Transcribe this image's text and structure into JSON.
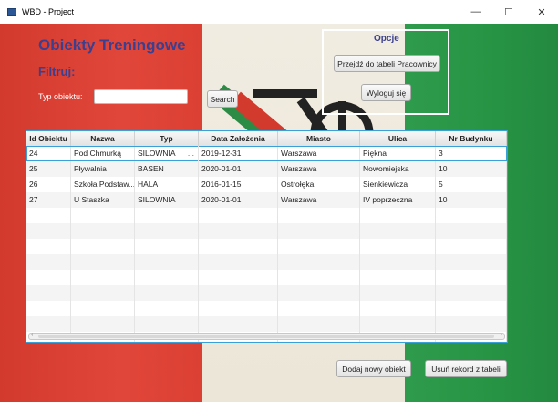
{
  "window": {
    "title": "WBD - Project",
    "min": "—",
    "max": "☐",
    "close": "✕"
  },
  "header": {
    "title": "Obiekty Treningowe",
    "filter_heading": "Filtruj:"
  },
  "filter": {
    "type_label": "Typ obiektu:",
    "type_value": "",
    "search_button": "Search"
  },
  "options": {
    "title": "Opcje",
    "go_to_employees": "Przejdź do tabeli Pracownicy",
    "logout": "Wyloguj się"
  },
  "table": {
    "columns": [
      "Id Obiektu",
      "Nazwa",
      "Typ",
      "Data Założenia",
      "Miasto",
      "Ulica",
      "Nr Budynku"
    ],
    "rows": [
      [
        "24",
        "Pod Chmurką",
        "SILOWNIA",
        "2019-12-31",
        "Warszawa",
        "Piękna",
        "3"
      ],
      [
        "25",
        "Pływalnia",
        "BASEN",
        "2020-01-01",
        "Warszawa",
        "Nowomiejska",
        "10"
      ],
      [
        "26",
        "Szkoła Podstaw...",
        "HALA",
        "2016-01-15",
        "Ostrołęka",
        "Sienkiewicza",
        "5"
      ],
      [
        "27",
        "U Staszka",
        "SILOWNIA",
        "2020-01-01",
        "Warszawa",
        "IV poprzeczna",
        "10"
      ]
    ],
    "selected_row": 0,
    "empty_rows": 10,
    "type_cell_ellipsis": "..."
  },
  "actions": {
    "add_new": "Dodaj nowy obiekt",
    "delete_record": "Usuń rekord z tabeli"
  },
  "colors": {
    "red": "#e1463a",
    "white": "#ece6d8",
    "green": "#279545",
    "heading": "#3a3f8f",
    "selection": "#3aa0d8"
  }
}
